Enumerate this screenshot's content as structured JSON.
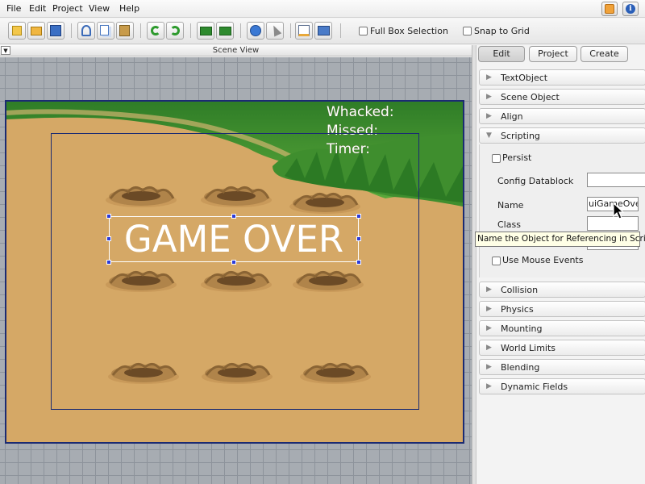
{
  "menu": {
    "items": [
      "File",
      "Edit",
      "Project",
      "View",
      "Help"
    ]
  },
  "menubar_right": {
    "icons": [
      "message-icon",
      "info-icon"
    ]
  },
  "toolbar": {
    "icons": [
      "new-icon",
      "open-icon",
      "save-icon",
      "cut-icon",
      "copy-icon",
      "paste-icon",
      "undo-icon",
      "redo-icon",
      "import-icon",
      "export-icon",
      "play-icon",
      "pointer-icon",
      "edit-icon",
      "screen-icon"
    ],
    "full_box_selection_label": "Full Box Selection",
    "full_box_selection_checked": false,
    "snap_to_grid_label": "Snap to Grid",
    "snap_to_grid_checked": false
  },
  "scene_view": {
    "title": "Scene View",
    "hud": {
      "whacked": "Whacked:",
      "missed": "Missed:",
      "timer": "Timer:"
    },
    "game_over_text": "GAME OVER"
  },
  "panel": {
    "tabs": [
      "Edit",
      "Project",
      "Create"
    ],
    "active_tab": "Edit",
    "sections_top": [
      "TextObject",
      "Scene Object",
      "Align"
    ],
    "scripting": {
      "title": "Scripting",
      "persist_label": "Persist",
      "persist_checked": false,
      "config_datablock_label": "Config Datablock",
      "config_datablock_value": "",
      "name_label": "Name",
      "name_value": "uiGameOver",
      "class_label": "Class",
      "class_value": "",
      "superclass_value": "",
      "use_mouse_events_label": "Use Mouse Events",
      "use_mouse_events_checked": false
    },
    "sections_bottom": [
      "Collision",
      "Physics",
      "Mounting",
      "World Limits",
      "Blending",
      "Dynamic Fields"
    ]
  },
  "tooltip": "Name the Object for Referencing in Script",
  "colors": {
    "scene_grid_bg": "#a7acb2",
    "frame_border": "#1b2b72",
    "sand": "#d5a866",
    "grass": "#3f8e2e",
    "selection_handle": "#2b3bd9"
  }
}
